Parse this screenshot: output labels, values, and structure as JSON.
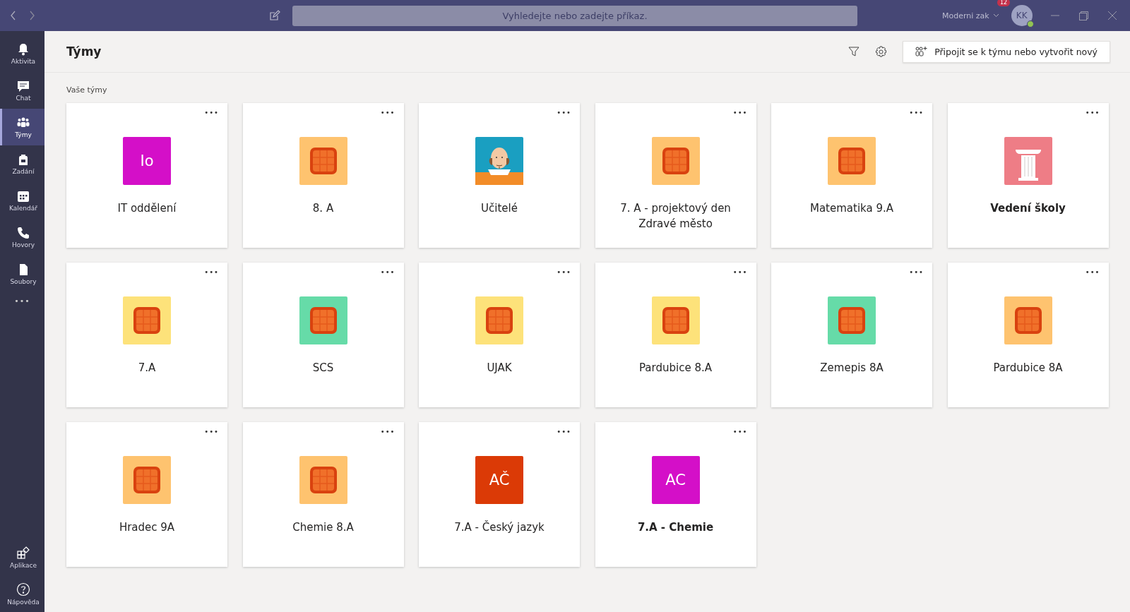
{
  "titlebar": {
    "search": {
      "placeholder": "Vyhledejte nebo zadejte příkaz."
    },
    "account": "Moderni zak",
    "badge": "12",
    "avatar": "KK"
  },
  "sidebar": {
    "items": [
      {
        "label": "Aktivita",
        "kind": "bell",
        "selected": false
      },
      {
        "label": "Chat",
        "kind": "chat",
        "selected": false
      },
      {
        "label": "Týmy",
        "kind": "teams",
        "selected": true
      },
      {
        "label": "Zadání",
        "kind": "bag",
        "selected": false
      },
      {
        "label": "Kalendář",
        "kind": "calendar",
        "selected": false
      },
      {
        "label": "Hovory",
        "kind": "phone",
        "selected": false
      },
      {
        "label": "Soubory",
        "kind": "file",
        "selected": false
      }
    ],
    "more": "•••",
    "bottom": [
      {
        "label": "Aplikace",
        "kind": "apps"
      },
      {
        "label": "Nápověda",
        "kind": "help"
      }
    ]
  },
  "header": {
    "title": "Týmy",
    "join_button": "Připojit se k týmu nebo vytvořit nový"
  },
  "section_label": "Vaše týmy",
  "teams": [
    {
      "name": "IT oddělení",
      "kind": "initials",
      "initials": "Io",
      "color": "#d40fc8",
      "unread": false
    },
    {
      "name": "8. A",
      "kind": "grid",
      "color": "#fec36f",
      "unread": false
    },
    {
      "name": "Učitelé",
      "kind": "cartoon",
      "unread": false
    },
    {
      "name": "7. A - projektový den Zdravé město",
      "kind": "grid",
      "color": "#fec36f",
      "unread": false
    },
    {
      "name": "Matematika 9.A",
      "kind": "grid",
      "color": "#fec36f",
      "unread": false
    },
    {
      "name": "Vedení školy",
      "kind": "column",
      "color": "#ee7d86",
      "unread": true
    },
    {
      "name": "7.A",
      "kind": "grid",
      "color": "#fde27a",
      "unread": false
    },
    {
      "name": "SCS",
      "kind": "grid",
      "color": "#66dba8",
      "unread": false
    },
    {
      "name": "UJAK",
      "kind": "grid",
      "color": "#fde27a",
      "unread": false
    },
    {
      "name": "Pardubice 8.A",
      "kind": "grid",
      "color": "#fde27a",
      "unread": false
    },
    {
      "name": "Zemepis 8A",
      "kind": "grid",
      "color": "#66dba8",
      "unread": false
    },
    {
      "name": "Pardubice 8A",
      "kind": "grid",
      "color": "#fec36f",
      "unread": false
    },
    {
      "name": "Hradec 9A",
      "kind": "grid",
      "color": "#fec36f",
      "unread": false
    },
    {
      "name": "Chemie 8.A",
      "kind": "grid",
      "color": "#fec36f",
      "unread": false
    },
    {
      "name": "7.A - Český jazyk",
      "kind": "initials",
      "initials": "AČ",
      "color": "#db3a06",
      "unread": false
    },
    {
      "name": "7.A - Chemie",
      "kind": "initials",
      "initials": "AC",
      "color": "#d40fc8",
      "unread": true
    }
  ],
  "card_menu": "•••"
}
